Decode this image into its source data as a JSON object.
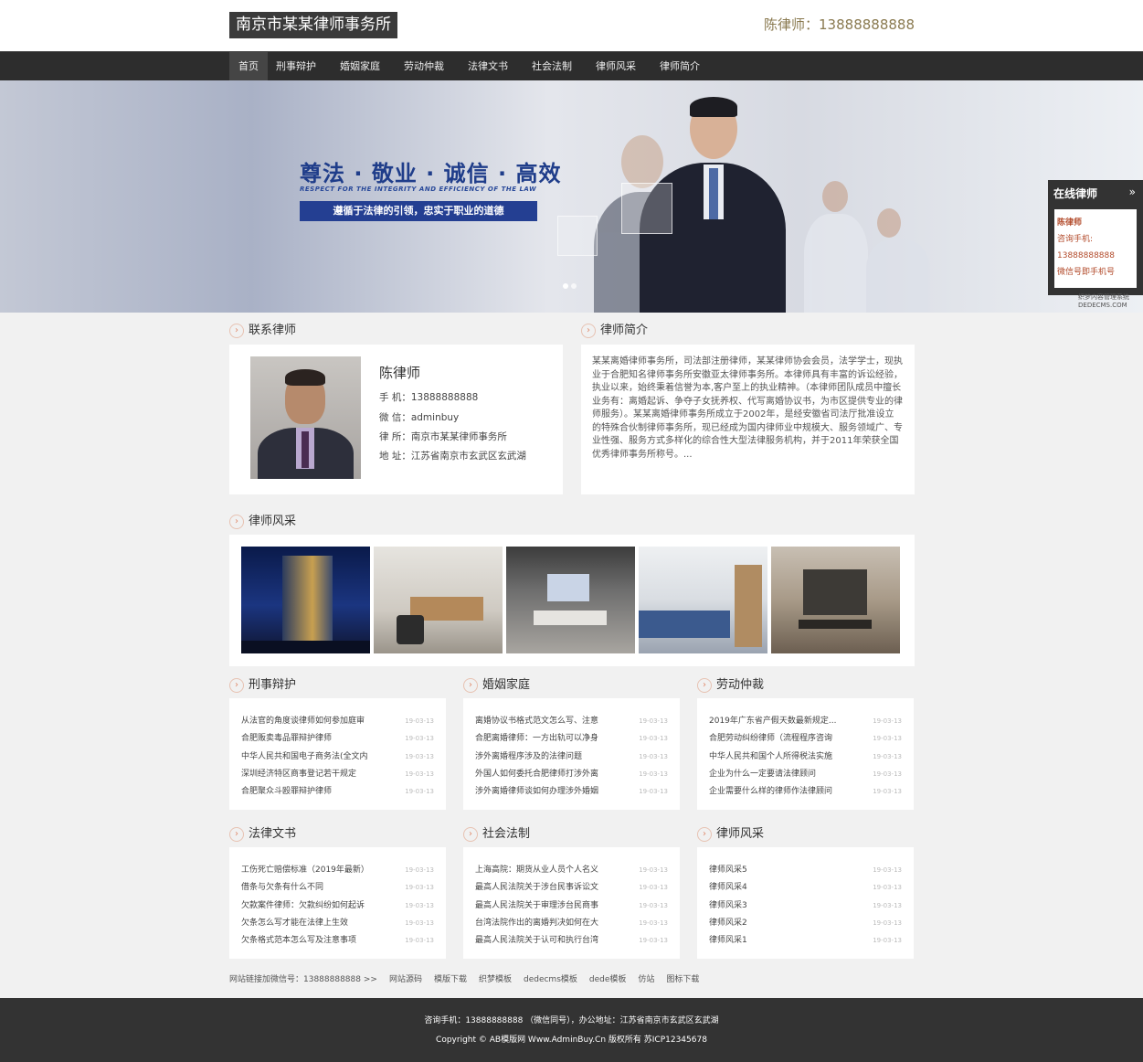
{
  "header": {
    "logo": "南京市某某律师事务所",
    "phone": "陈律师：13888888888"
  },
  "nav": [
    "首页",
    "刑事辩护",
    "婚姻家庭",
    "劳动仲裁",
    "法律文书",
    "社会法制",
    "律师风采",
    "律师简介"
  ],
  "banner": {
    "slogan": "尊法 · 敬业 · 诚信 · 高效",
    "slogan_en": "RESPECT FOR THE INTEGRITY AND EFFICIENCY OF THE LAW",
    "slogan_sub": "遵循于法律的引领，忠实于职业的道德"
  },
  "online": {
    "title": "在线律师",
    "arrow": "»",
    "items": [
      "陈律师",
      "咨询手机:",
      "13888888888",
      "微信号即手机号"
    ]
  },
  "watermark": "织梦内容管理系统 DEDECMS.COM",
  "contact": {
    "title": "联系律师",
    "name": "陈律师",
    "phone": "手  机：13888888888",
    "wechat": "微  信：adminbuy",
    "firm": "律  所：南京市某某律师事务所",
    "address": "地  址：江苏省南京市玄武区玄武湖"
  },
  "intro": {
    "title": "律师简介",
    "text": "某某离婚律师事务所，司法部注册律师，某某律师协会会员，法学学士，现执业于合肥知名律师事务所安徽亚太律师事务所。本律师具有丰富的诉讼经验，执业以来，始终秉着信誉为本,客户至上的执业精神。（本律师团队成员中擅长业务有：离婚起诉、争夺子女抚养权、代写离婚协议书，为市区提供专业的律师服务）。某某离婚律师事务所成立于2002年，是经安徽省司法厅批准设立的特殊合伙制律师事务所，现已经成为国内律师业中规模大、服务领域广、专业性强、服务方式多样化的综合性大型法律服务机构，并于2011年荣获全国优秀律师事务所称号。..."
  },
  "gallery": {
    "title": "律师风采"
  },
  "sections": [
    {
      "title": "刑事辩护",
      "items": [
        {
          "t": "从法官的角度谈律师如何参加庭审",
          "d": "19-03-13"
        },
        {
          "t": "合肥贩卖毒品罪辩护律师",
          "d": "19-03-13"
        },
        {
          "t": "中华人民共和国电子商务法(全文内",
          "d": "19-03-13"
        },
        {
          "t": "深圳经济特区商事登记若干规定",
          "d": "19-03-13"
        },
        {
          "t": "合肥聚众斗殴罪辩护律师",
          "d": "19-03-13"
        }
      ]
    },
    {
      "title": "婚姻家庭",
      "items": [
        {
          "t": "离婚协议书格式范文怎么写、注意",
          "d": "19-03-13"
        },
        {
          "t": "合肥离婚律师：一方出轨可以净身",
          "d": "19-03-13"
        },
        {
          "t": "涉外离婚程序涉及的法律问题",
          "d": "19-03-13"
        },
        {
          "t": "外国人如何委托合肥律师打涉外离",
          "d": "19-03-13"
        },
        {
          "t": "涉外离婚律师谈如何办理涉外婚姻",
          "d": "19-03-13"
        }
      ]
    },
    {
      "title": "劳动仲裁",
      "items": [
        {
          "t": "2019年广东省产假天数最新规定...",
          "d": "19-03-13"
        },
        {
          "t": "合肥劳动纠纷律师（流程程序咨询",
          "d": "19-03-13"
        },
        {
          "t": "中华人民共和国个人所得税法实施",
          "d": "19-03-13"
        },
        {
          "t": "企业为什么一定要请法律顾问",
          "d": "19-03-13"
        },
        {
          "t": "企业需要什么样的律师作法律顾问",
          "d": "19-03-13"
        }
      ]
    },
    {
      "title": "法律文书",
      "items": [
        {
          "t": "工伤死亡赔偿标准（2019年最新）",
          "d": "19-03-13"
        },
        {
          "t": "借条与欠条有什么不同",
          "d": "19-03-13"
        },
        {
          "t": "欠款案件律师：欠款纠纷如何起诉",
          "d": "19-03-13"
        },
        {
          "t": "欠条怎么写才能在法律上生效",
          "d": "19-03-13"
        },
        {
          "t": "欠条格式范本怎么写及注意事项",
          "d": "19-03-13"
        }
      ]
    },
    {
      "title": "社会法制",
      "items": [
        {
          "t": "上海高院：期货从业人员个人名义",
          "d": "19-03-13"
        },
        {
          "t": "最高人民法院关于涉台民事诉讼文",
          "d": "19-03-13"
        },
        {
          "t": "最高人民法院关于审理涉台民商事",
          "d": "19-03-13"
        },
        {
          "t": "台湾法院作出的离婚判决如何在大",
          "d": "19-03-13"
        },
        {
          "t": "最高人民法院关于认可和执行台湾",
          "d": "19-03-13"
        }
      ]
    },
    {
      "title": "律师风采",
      "items": [
        {
          "t": "律师风采5",
          "d": "19-03-13"
        },
        {
          "t": "律师风采4",
          "d": "19-03-13"
        },
        {
          "t": "律师风采3",
          "d": "19-03-13"
        },
        {
          "t": "律师风采2",
          "d": "19-03-13"
        },
        {
          "t": "律师风采1",
          "d": "19-03-13"
        }
      ]
    }
  ],
  "links": [
    "网站链接加微信号：13888888888 >>",
    "网站源码",
    "模版下载",
    "织梦模板",
    "dedecms模板",
    "dede模板",
    "仿站",
    "图标下载"
  ],
  "footer": {
    "line1": "咨询手机：13888888888 （微信同号），办公地址：江苏省南京市玄武区玄武湖",
    "line2": "Copyright © AB模版网 Www.AdminBuy.Cn 版权所有   苏ICP12345678"
  }
}
